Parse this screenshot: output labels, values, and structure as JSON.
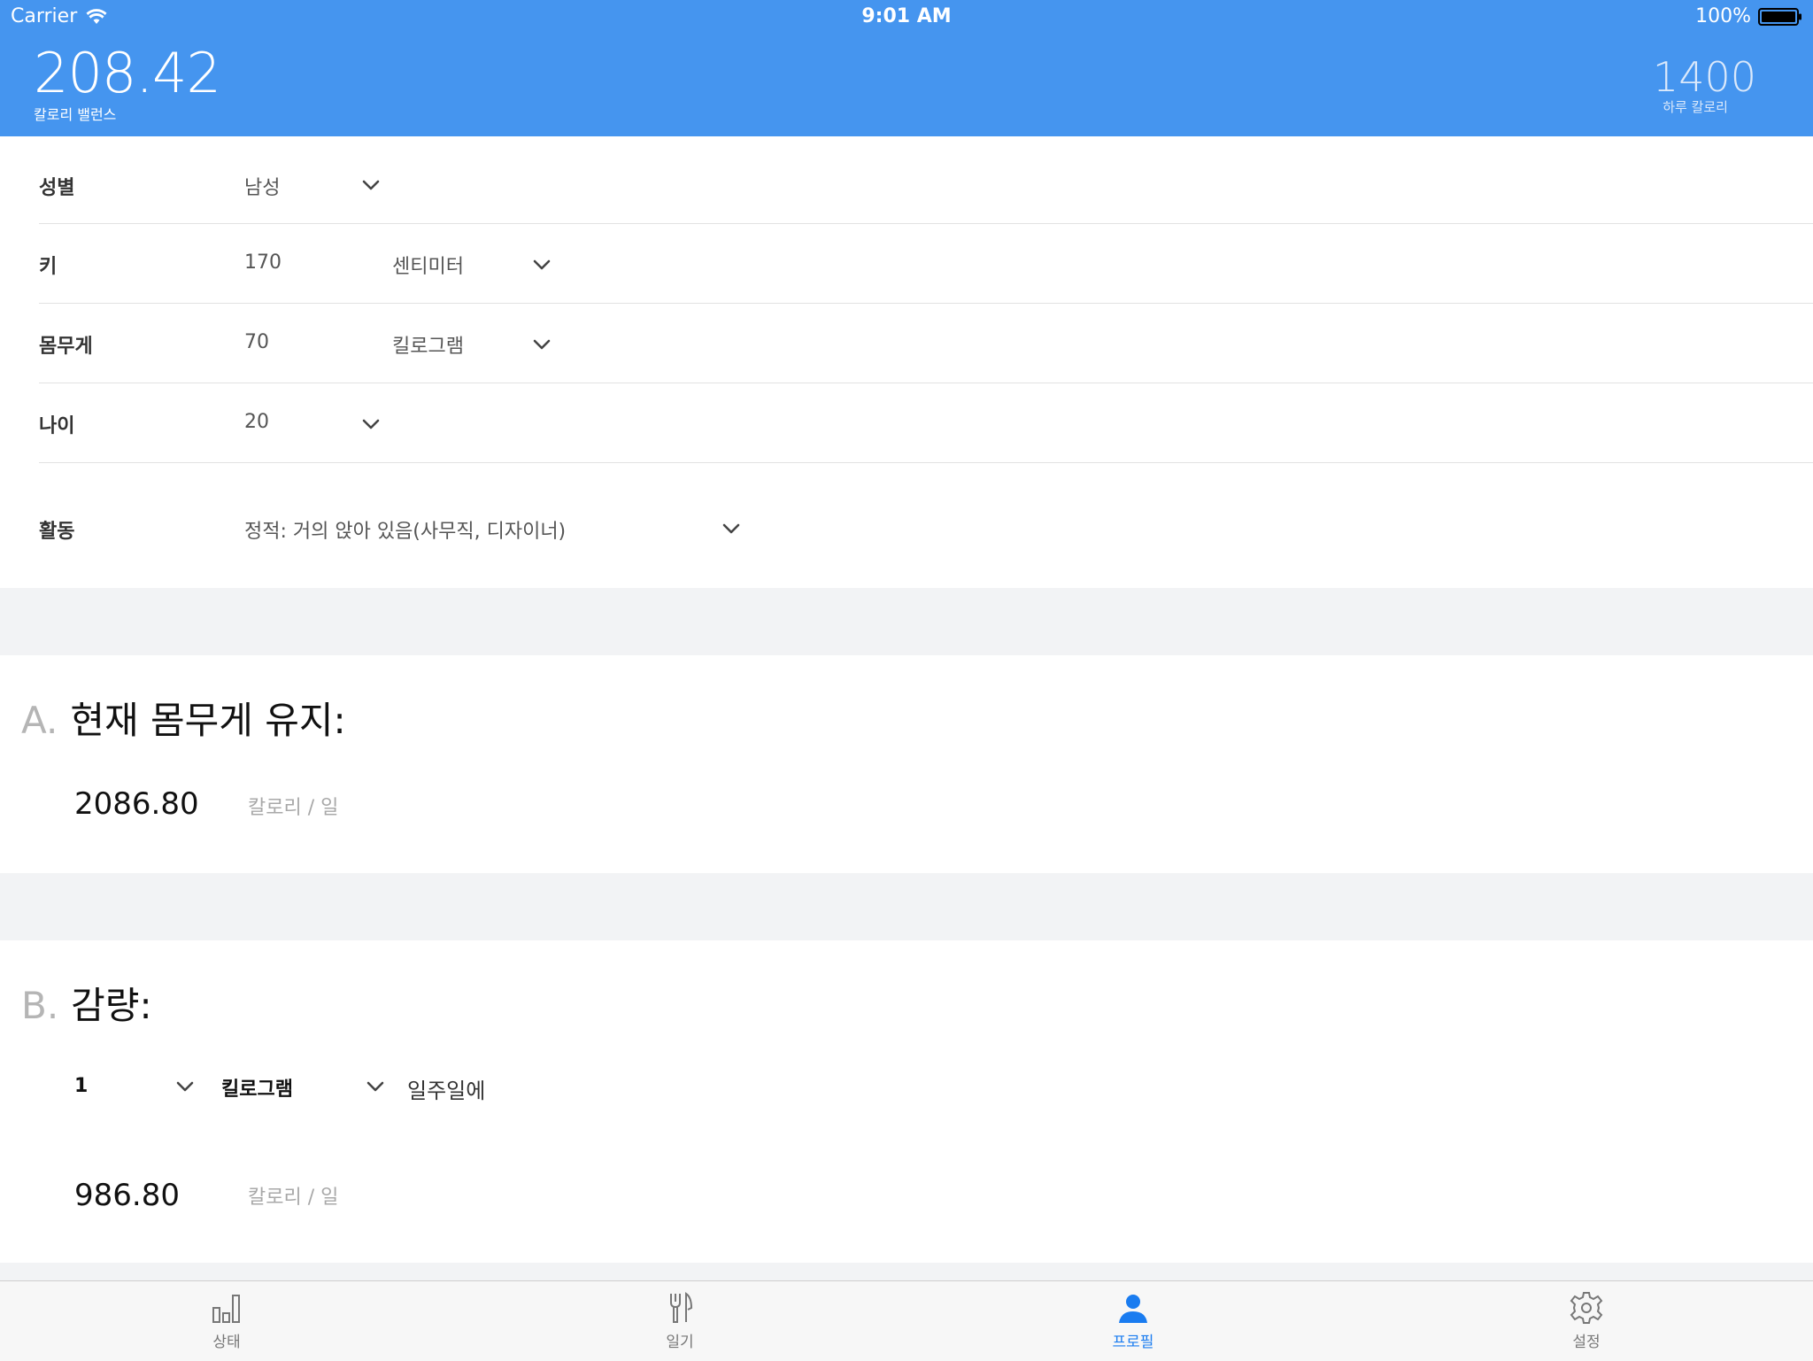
{
  "status_bar": {
    "carrier": "Carrier",
    "time": "9:01 AM",
    "battery": "100%"
  },
  "header": {
    "balance_value": "208.42",
    "balance_label": "칼로리 밸런스",
    "daily_value": "1400",
    "daily_label": "하루 칼로리"
  },
  "form": {
    "gender": {
      "label": "성별",
      "value": "남성"
    },
    "height": {
      "label": "키",
      "value": "170",
      "unit": "센티미터"
    },
    "weight": {
      "label": "몸무게",
      "value": "70",
      "unit": "킬로그램"
    },
    "age": {
      "label": "나이",
      "value": "20"
    },
    "activity": {
      "label": "활동",
      "value": "정적: 거의 앉아 있음(사무직, 디자이너)"
    }
  },
  "section_a": {
    "letter": "A.",
    "title": "현재 몸무게 유지:",
    "calories": "2086.80",
    "unit": "칼로리 / 일"
  },
  "section_b": {
    "letter": "B.",
    "title": "감량:",
    "amount": "1",
    "amount_unit": "킬로그램",
    "period": "일주일에",
    "calories": "986.80",
    "unit": "칼로리 / 일"
  },
  "tabs": [
    {
      "label": "상태",
      "icon": "bar-chart-icon"
    },
    {
      "label": "일기",
      "icon": "fork-knife-icon"
    },
    {
      "label": "프로필",
      "icon": "person-icon",
      "active": true
    },
    {
      "label": "설정",
      "icon": "gear-icon"
    }
  ],
  "colors": {
    "accent": "#4595ef",
    "active_tab": "#1a7cf0"
  }
}
